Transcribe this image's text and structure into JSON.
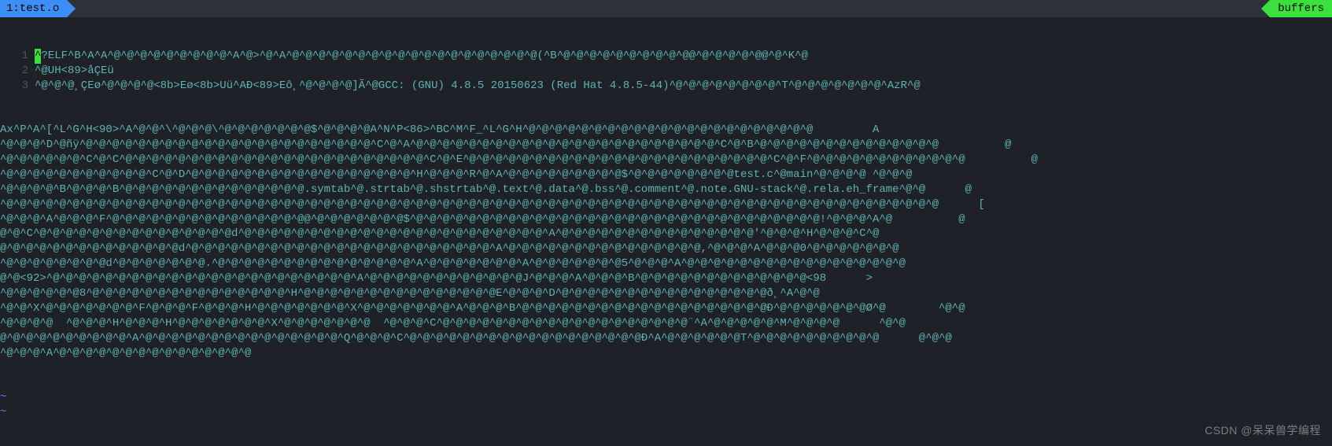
{
  "tab": {
    "index": "1",
    "filename": "test.o"
  },
  "buffers_label": "buffers",
  "lines": [
    {
      "num": "1",
      "hasCursor": true,
      "cursorChar": "^",
      "text": "?ELF^B^A^A^@^@^@^@^@^@^@^@^@^A^@>^@^A^@^@^@^@^@^@^@^@^@^@^@^@^@^@^@^@^@^@^@(^B^@^@^@^@^@^@^@^@^@^@@^@^@^@^@^@@^@^K^@"
    },
    {
      "num": "2",
      "text": "^@UH<89>åÇEü"
    },
    {
      "num": "3",
      "text": "^@^@^@¸ÇEø^@^@^@^@<8b>Eø<8b>Uü^AÐ<89>Eô¸^@^@^@^@]Ã^@GCC: (GNU) 4.8.5 20150623 (Red Hat 4.8.5-44)^@^@^@^@^@^@^@^@^T^@^@^@^@^@^@^@^AzR^@"
    }
  ],
  "wrapped_body": "Ax^P^A^[^L^G^H<90>^A^@^@^\\^@^@^@\\^@^@^@^@^@^@^@$^@^@^@^@A^N^P<86>^BC^M^F_^L^G^H^@^@^@^@^@^@^@^@^@^@^@^@^@^@^@^@^@^@^@^@^@^@         A\n^@^@^@^D^@ñÿ^@^@^@^@^@^@^@^@^@^@^@^@^@^@^@^@^@^@^@^@^@^@^C^@^A^@^@^@^@^@^@^@^@^@^@^@^@^@^@^@^@^@^@^@^@^@^@^@^C^@^B^@^@^@^@^@^@^@^@^@^@^@^@^@^@          @\n^@^@^@^@^@^@^C^@^C^@^@^@^@^@^@^@^@^@^@^@^@^@^@^@^@^@^@^@^@^@^@^@^C^@^E^@^@^@^@^@^@^@^@^@^@^@^@^@^@^@^@^@^@^@^@^@^@^@^C^@^F^@^@^@^@^@^@^@^@^@^@^@^@          @\n^@^@^@^@^@^@^@^@^@^@^@^C^@^D^@^@^@^@^@^@^@^@^@^@^@^@^@^@^@^@^@^H^@^@^@^R^@^A^@^@^@^@^@^@^@^@^@$^@^@^@^@^@^@^@^@test.c^@main^@^@^@^@ ^@^@^@\n^@^@^@^@^B^@^@^@^B^@^@^@^@^@^@^@^@^@^@^@^@^@^@.symtab^@.strtab^@.shstrtab^@.text^@.data^@.bss^@.comment^@.note.GNU-stack^@.rela.eh_frame^@^@      @\n^@^@^@^@^@^@^@^@^@^@^@^@^@^@^@^@^@^@^@^@^@^@^@^@^@^@^@^@^@^@^@^@^@^@^@^@^@^@^@^@^@^@^@^@^@^@^@^@^@^@^@^@^@^@^@^@^@^@^@^@^@^@^@^@^@^@^@^@^@^@^@      [\n^@^@^@^A^@^@^@^F^@^@^@^@^@^@^@^@^@^@^@^@^@^@^@@^@^@^@^@^@^@^@$^@^@^@^@^@^@^@^@^@^@^@^@^@^@^@^@^@^@^@^@^@^@^@^@^@^@^@^@^@^@^@!^@^@^@^A^@          @\n@^@^C^@^@^@^@^@^@^@^@^@^@^@^@^@^@^@d^@^@^@^@^@^@^@^@^@^@^@^@^@^@^@^@^@^@^@^@^@^@^@^A^@^@^@^@^@^@^@^@^@^@^@^@^@^@^@'^@^@^@^H^@^@^@^C^@\n@^@^@^@^@^@^@^@^@^@^@^@^@^@d^@^@^@^@^@^@^@^@^@^@^@^@^@^@^@^@^@^@^@^@^@^@^@^A^@^@^@^@^@^@^@^@^@^@^@^@^@^@^@,^@^@^@^A^@^@^@0^@^@^@^@^@^@^@\n^@^@^@^@^@^@^@^@d^@^@^@^@^@^@^@.^@^@^@^@^@^@^@^@^@^@^@^@^@^@^@^A^@^@^@^@^@^@^@^A^@^@^@^@^@^@^@5^@^@^@^A^@^@^@^@^@^@^@^@^@^@^@^@^@^@^@^@^@\n@^@<92>^@^@^@^@^@^@^@^@^@^@^@^@^@^@^@^@^@^@^@^@^@^@^@^A^@^@^@^@^@^@^@^@^@^@^@^@J^@^@^@^A^@^@^@^B^@^@^@^@^@^@^@^@^@^@^@^@^@<98      >\n^@^@^@^@^@^@8^@^@^@^@^@^@^@^@^@^@^@^@^@^@^@^H^@^@^@^@^@^@^@^@^@^@^@^@^@^@^@E^@^@^@^D^@^@^@^@^@^@^@^@^@^@^@^@^@^@^@^@ð¸^A^@^@\n^@^@^X^@^@^@^@^@^@^@^F^@^@^@^F^@^@^@^H^@^@^@^@^@^@^@^X^@^@^@^@^@^@^@^A^@^@^@^B^@^@^@^@^@^@^@^@^@^@^@^@^@^@^@^@^@^@^@Ð^@^@^@^@^@^@^@Ø^@        ^@^@\n^@^@^@^@  ^@^@^@^H^@^@^@^H^@^@^@^@^@^@^@^X^@^@^@^@^@^@^@  ^@^@^@^C^@^@^@^@^@^@^@^@^@^@^@^@^@^@^@^@^@^@^@¨^A^@^@^@^@^@^M^@^@^@^@      ^@^@\n@^@^@^@^@^@^@^@^@^@^A^@^@^@^@^@^@^@^@^@^@^@^@^@^@^@^Q^@^@^@^C^@^@^@^@^@^@^@^@^@^@^@^@^@^@^@^@^@^@Ð^A^@^@^@^@^@^@T^@^@^@^@^@^@^@^@^@^@      @^@^@\n^@^@^@^A^@^@^@^@^@^@^@^@^@^@^@^@^@^@^@",
  "tilde_count": 2,
  "watermark": "CSDN @呆呆兽学编程"
}
